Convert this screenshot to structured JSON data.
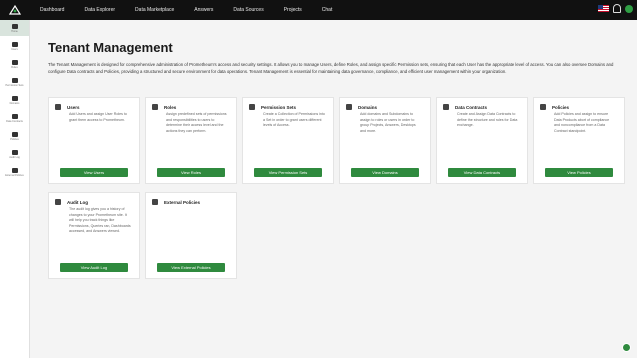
{
  "nav": {
    "items": [
      "Dashboard",
      "Data Explorer",
      "Data Marketplace",
      "Answers",
      "Data Sources",
      "Projects",
      "Chat"
    ]
  },
  "sidebar": {
    "items": [
      {
        "label": "Home",
        "icon": "home-icon"
      },
      {
        "label": "Users",
        "icon": "users-icon"
      },
      {
        "label": "Roles",
        "icon": "roles-icon"
      },
      {
        "label": "Permission Sets",
        "icon": "shield-icon"
      },
      {
        "label": "Domains",
        "icon": "domains-icon"
      },
      {
        "label": "Data Contracts",
        "icon": "contracts-icon"
      },
      {
        "label": "Policies",
        "icon": "policies-icon"
      },
      {
        "label": "Audit Log",
        "icon": "audit-icon"
      },
      {
        "label": "External Policies",
        "icon": "external-icon"
      }
    ]
  },
  "page": {
    "title": "Tenant Management",
    "intro": "The Tenant Management is designed for comprehensive administration of Prometheum's access and security settings. It allows you to manage Users, define Roles, and assign specific Permission sets, ensuring that each User has the appropriate level of access. You can also oversee Domains and configure Data contracts and Policies, providing a structured and secure environment for data operations. Tenant Management is essential for maintaining data governance, compliance, and efficient user management within your organization."
  },
  "cards": [
    {
      "title": "Users",
      "desc": "Add Users and assign User Roles to grant them access to Prometheum.",
      "button": "View Users",
      "icon": "users-icon"
    },
    {
      "title": "Roles",
      "desc": "Assign predefined sets of permissions and responsibilities to users to determine their access level and the actions they can perform.",
      "button": "View Roles",
      "icon": "roles-icon"
    },
    {
      "title": "Permission Sets",
      "desc": "Create a Collection of Permissions into a Set in order to grant users different levels of Access.",
      "button": "View Permission Sets",
      "icon": "shield-icon"
    },
    {
      "title": "Domains",
      "desc": "Add domains and Subdomains to assign to roles or users in order to group Projects, Answers, Desktops and more.",
      "button": "View Domains",
      "icon": "domains-icon"
    },
    {
      "title": "Data Contracts",
      "desc": "Create and Assign Data Contracts to define the structure and rules for Data exchange.",
      "button": "View Data Contracts",
      "icon": "contracts-icon"
    },
    {
      "title": "Policies",
      "desc": "Add Policies and assign to ensure Data Products abort of compliance and noncompliance from a Data Contract standpoint.",
      "button": "View Policies",
      "icon": "policies-icon"
    }
  ],
  "cards2": [
    {
      "title": "Audit Log",
      "desc": "The audit log gives you a history of changes to your Prometheum site. It will help you track things like Permissions, Queries ran, Dashboards accessed, and Answers viewed.",
      "button": "View Audit Log",
      "icon": "audit-icon"
    },
    {
      "title": "External Policies",
      "desc": "",
      "button": "View External Policies",
      "icon": "external-icon"
    }
  ],
  "colors": {
    "accent": "#2f8a3e",
    "topbar": "#111111"
  }
}
